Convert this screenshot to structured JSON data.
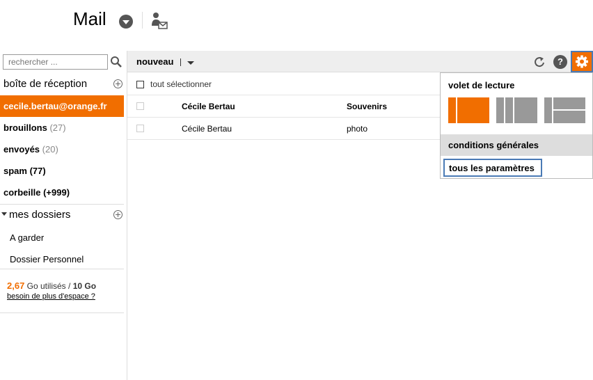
{
  "header": {
    "title": "Mail"
  },
  "search": {
    "placeholder": "rechercher ..."
  },
  "sidebar": {
    "inbox_label": "boîte de réception",
    "account": "cecile.bertau@orange.fr",
    "items": [
      {
        "label": "brouillons",
        "count": "(27)"
      },
      {
        "label": "envoyés",
        "count": "(20)"
      },
      {
        "label": "spam",
        "count": "(77)"
      },
      {
        "label": "corbeille",
        "count": "(+999)"
      }
    ],
    "folders_label": "mes dossiers",
    "folders": [
      "A garder",
      "Dossier Personnel"
    ],
    "storage": {
      "used": "2,67",
      "used_unit": "Go utilisés /",
      "total": "10 Go",
      "more_link": "besoin de plus d'espace ?"
    }
  },
  "toolbar": {
    "new_label": "nouveau",
    "help_glyph": "?"
  },
  "list": {
    "select_all": "tout sélectionner",
    "rows": [
      {
        "sender": "Cécile Bertau",
        "subject": "Souvenirs",
        "unread": true
      },
      {
        "sender": "Cécile Bertau",
        "subject": "photo",
        "unread": false
      }
    ]
  },
  "settings_menu": {
    "reading_pane_title": "volet de lecture",
    "terms": "conditions générales",
    "all_settings": "tous les paramètres"
  },
  "colors": {
    "accent": "#f16e00",
    "focus": "#4a7ab5",
    "icon": "#555555",
    "layout_inactive": "#999999"
  },
  "icons": [
    "chevron-down-icon",
    "contact-mail-icon",
    "search-icon",
    "plus-circle-icon",
    "refresh-icon",
    "help-icon",
    "gear-icon"
  ]
}
